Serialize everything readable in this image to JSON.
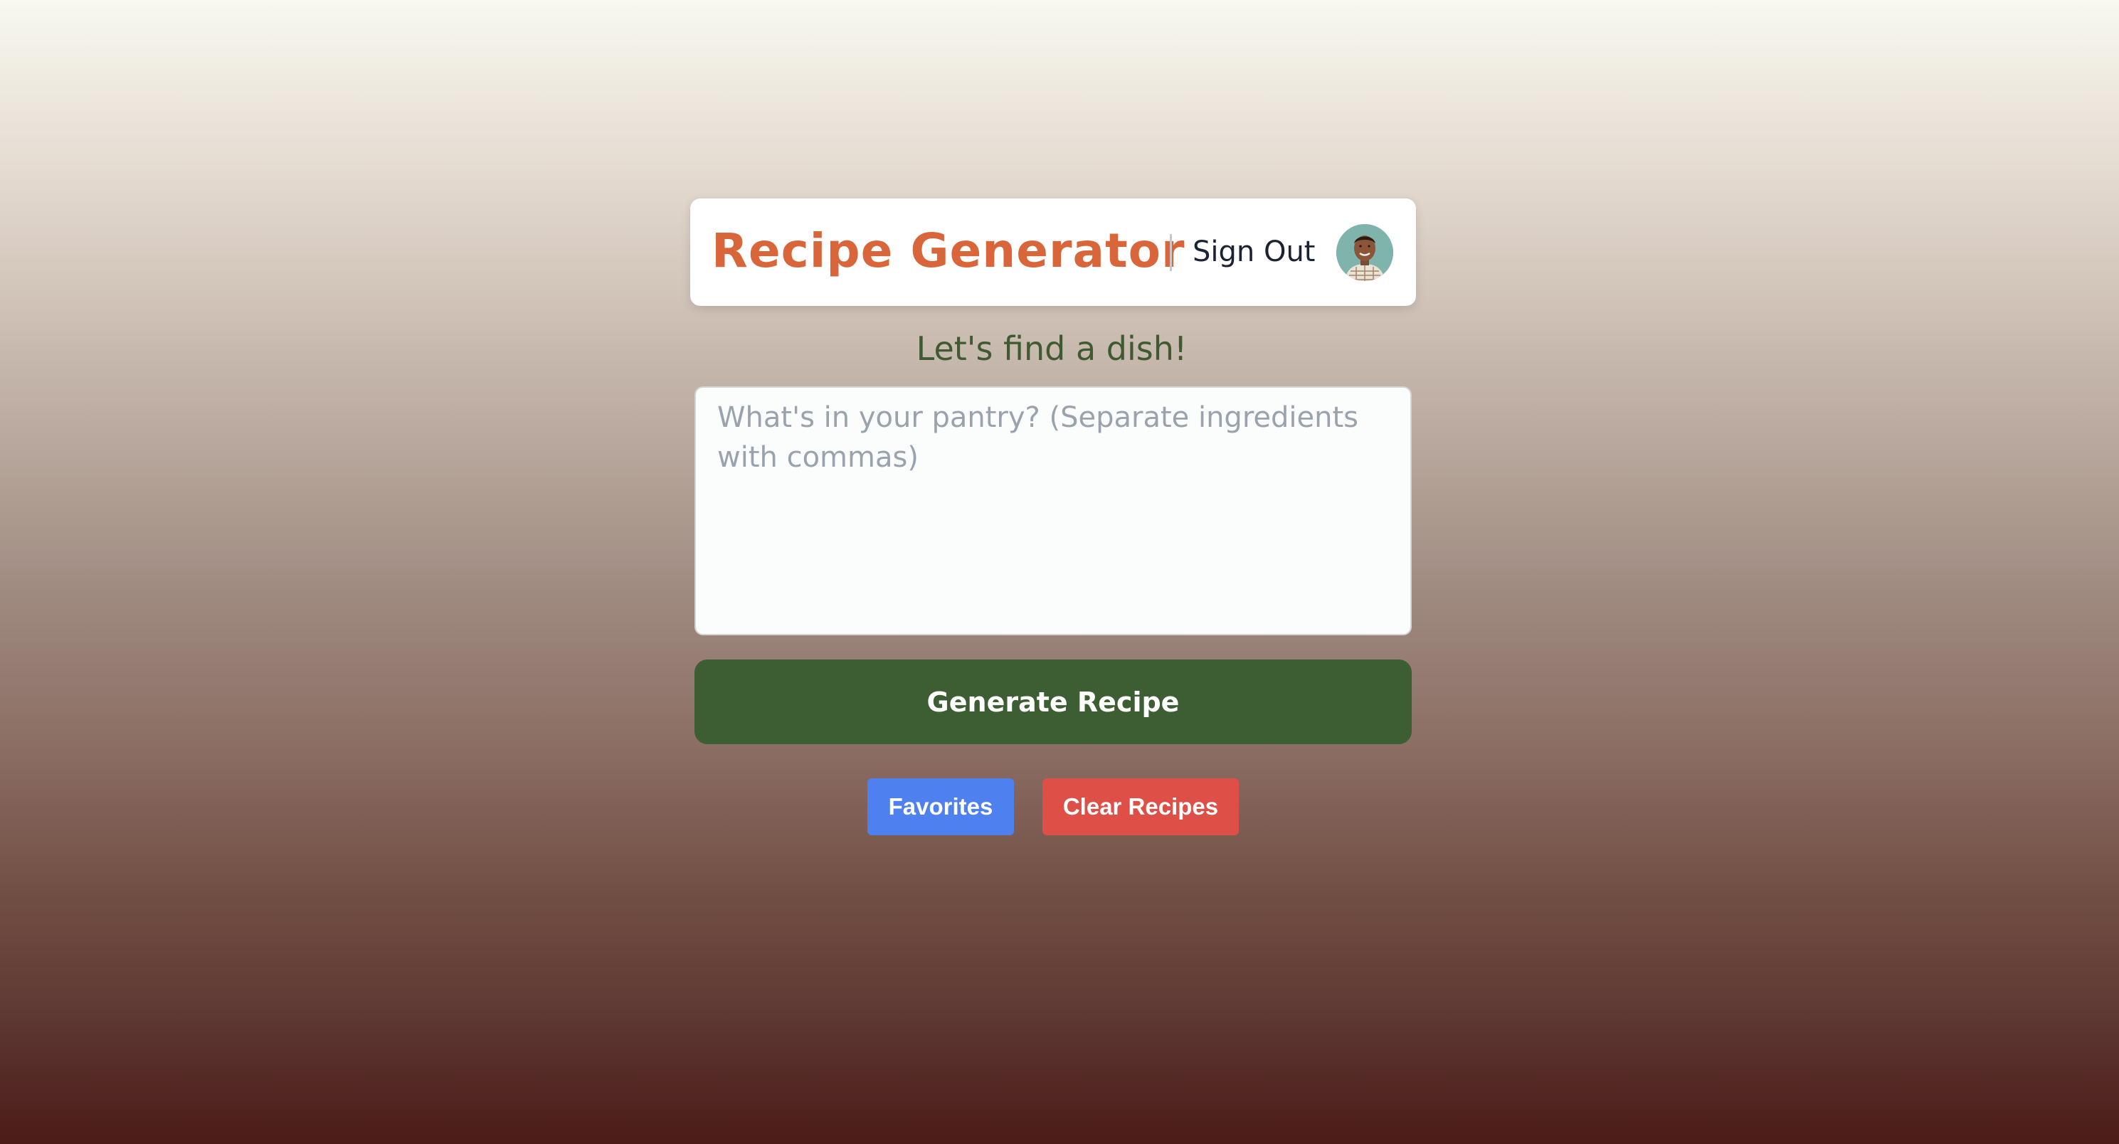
{
  "header": {
    "title": "Recipe Generator",
    "sign_out_label": "Sign Out",
    "avatar_icon": "user-avatar-photo"
  },
  "main": {
    "heading": "Let's find a dish!",
    "ingredients_input": {
      "value": "",
      "placeholder": "What's in your pantry? (Separate ingredients with commas)"
    },
    "generate_label": "Generate Recipe"
  },
  "actions": {
    "favorites_label": "Favorites",
    "clear_label": "Clear Recipes"
  },
  "colors": {
    "title": "#d9663a",
    "heading": "#3f5a30",
    "generate_button": "#3d5e33",
    "favorites_button": "#4f80ef",
    "clear_button": "#dd4f47"
  }
}
